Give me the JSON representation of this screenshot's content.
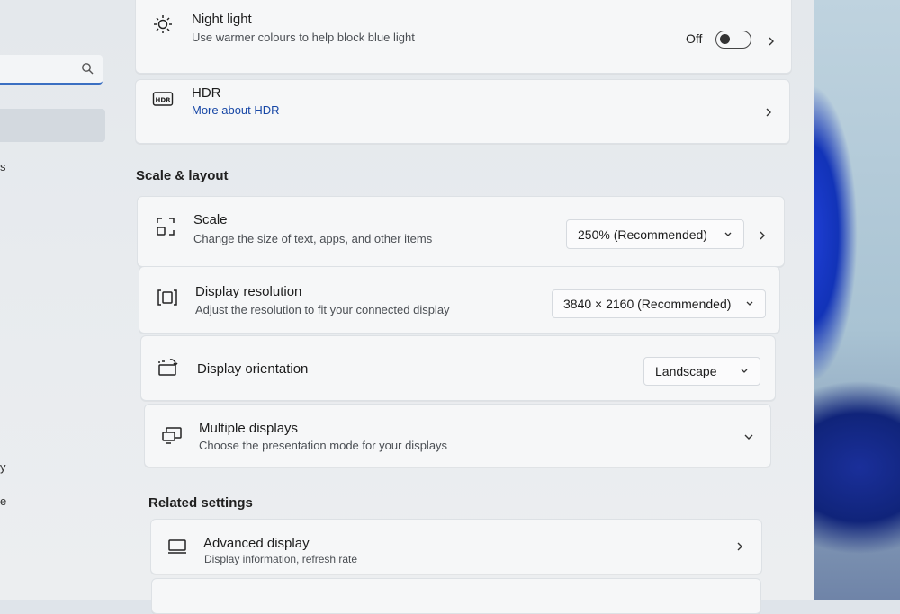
{
  "night_light": {
    "title": "Night light",
    "subtitle": "Use warmer colours to help block blue light",
    "toggle_state": "Off"
  },
  "hdr": {
    "title": "HDR",
    "link": "More about HDR"
  },
  "scale_layout": {
    "heading": "Scale & layout",
    "scale": {
      "title": "Scale",
      "subtitle": "Change the size of text, apps, and other items",
      "value": "250% (Recommended)"
    },
    "resolution": {
      "title": "Display resolution",
      "subtitle": "Adjust the resolution to fit your connected display",
      "value": "3840 × 2160 (Recommended)"
    },
    "orientation": {
      "title": "Display orientation",
      "value": "Landscape"
    },
    "multiple": {
      "title": "Multiple displays",
      "subtitle": "Choose the presentation mode for your displays"
    }
  },
  "related": {
    "heading": "Related settings",
    "advanced": {
      "title": "Advanced display",
      "subtitle": "Display information, refresh rate"
    }
  },
  "sidebar": {
    "fragments": [
      "s",
      "y",
      "e"
    ]
  },
  "icons": {
    "search": "search-icon",
    "night_light": "brightness-icon",
    "hdr": "hdr-icon",
    "scale": "scale-icon",
    "resolution": "resolution-icon",
    "orientation": "orientation-icon",
    "multiple": "multiple-displays-icon",
    "advanced": "monitor-icon"
  }
}
